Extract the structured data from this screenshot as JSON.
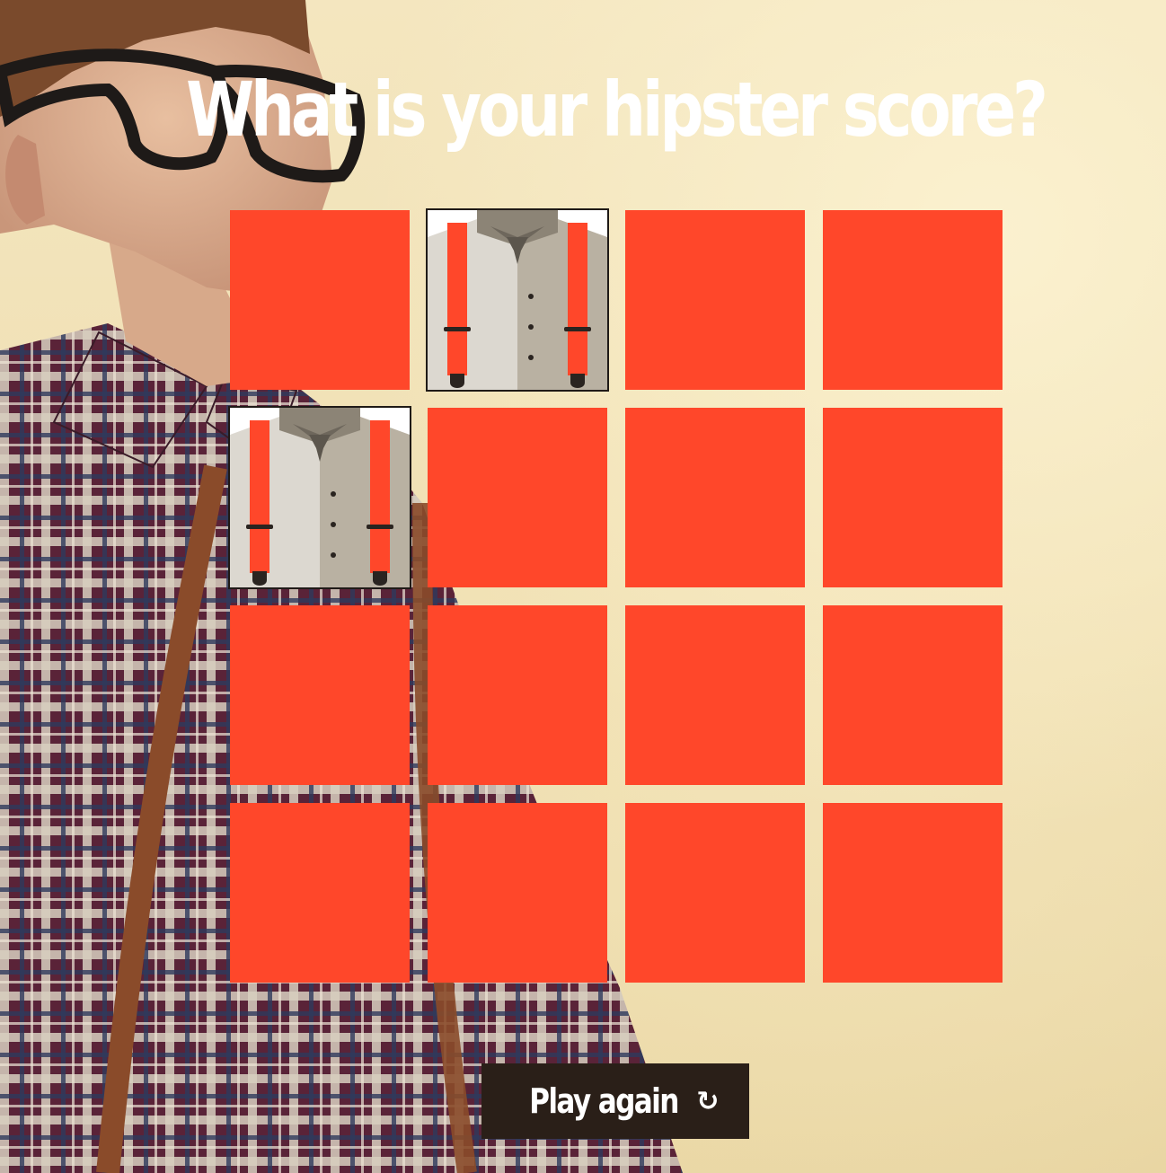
{
  "header": {
    "title": "What is your hipster score?"
  },
  "board": {
    "rows": 4,
    "cols": 4,
    "card_back_color": "#ff472a",
    "cards": [
      {
        "state": "face-down"
      },
      {
        "state": "face-up",
        "icon": "suspenders-shirt-icon"
      },
      {
        "state": "face-down"
      },
      {
        "state": "face-down"
      },
      {
        "state": "face-up",
        "icon": "suspenders-shirt-icon"
      },
      {
        "state": "face-down"
      },
      {
        "state": "face-down"
      },
      {
        "state": "face-down"
      },
      {
        "state": "face-down"
      },
      {
        "state": "face-down"
      },
      {
        "state": "face-down"
      },
      {
        "state": "face-down"
      },
      {
        "state": "face-down"
      },
      {
        "state": "face-down"
      },
      {
        "state": "face-down"
      },
      {
        "state": "face-down"
      }
    ]
  },
  "controls": {
    "play_again_label": "Play again",
    "play_again_icon": "↻",
    "play_again_color": "#2a1f18"
  },
  "background": {
    "icon": "hipster-man-photo",
    "shirt_color": "#6b2a3a"
  }
}
